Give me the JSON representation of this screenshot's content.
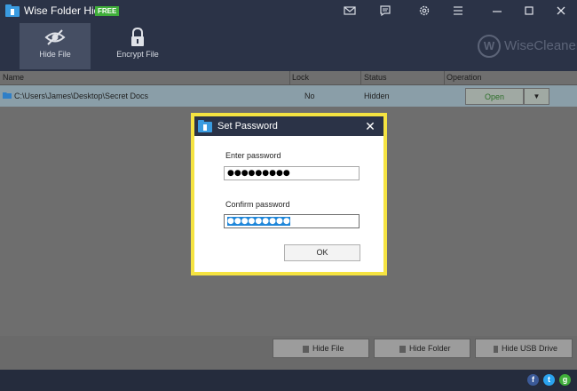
{
  "app": {
    "title": "Wise Folder Hider",
    "badge": "FREE",
    "brand": "WiseCleaner",
    "brand_mark": "W",
    "colors": {
      "titlebar": "#2b3347",
      "badge": "#3fae3a",
      "accent_yellow": "#f5e341",
      "selection": "#1e86d9"
    }
  },
  "titlebar_icons": [
    "mail-icon",
    "feedback-icon",
    "settings-icon",
    "menu-icon",
    "minimize-icon",
    "maximize-icon",
    "close-icon"
  ],
  "toolbar": {
    "hide_file_label": "Hide File",
    "encrypt_file_label": "Encrypt File"
  },
  "table": {
    "columns": [
      "Name",
      "Lock",
      "Status",
      "Operation"
    ],
    "rows": [
      {
        "name": "C:\\Users\\James\\Desktop\\Secret Docs",
        "lock": "No",
        "status": "Hidden",
        "operation": "Open",
        "dropdown": "▼"
      }
    ]
  },
  "bottom_buttons": {
    "hide_file": "Hide File",
    "hide_folder": "Hide Folder",
    "hide_usb": "Hide USB Drive"
  },
  "social": [
    "f",
    "t",
    "g"
  ],
  "dialog": {
    "title": "Set Password",
    "close": "✕",
    "enter_label": "Enter password",
    "enter_value": "●●●●●●●●●",
    "confirm_label": "Confirm password",
    "confirm_value": "●●●●●●●●●",
    "ok_label": "OK"
  }
}
